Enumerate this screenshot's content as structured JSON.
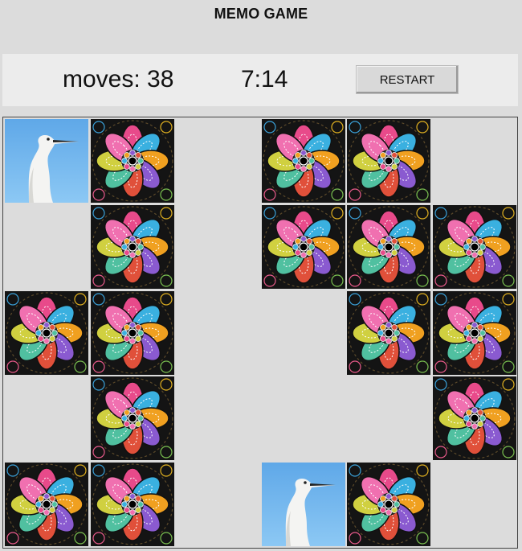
{
  "title": "MEMO GAME",
  "score": {
    "moves_label": "moves:",
    "moves": "38",
    "time": "7:14",
    "restart_label": "RESTART"
  },
  "board": {
    "rows": 5,
    "cols": 6,
    "cells": [
      [
        "egret",
        "mandala",
        "empty",
        "mandala",
        "mandala",
        "empty"
      ],
      [
        "empty",
        "mandala",
        "empty",
        "mandala",
        "mandala",
        "mandala"
      ],
      [
        "mandala",
        "mandala",
        "empty",
        "empty",
        "mandala",
        "mandala"
      ],
      [
        "empty",
        "mandala",
        "empty",
        "empty",
        "empty",
        "mandala"
      ],
      [
        "mandala",
        "mandala",
        "empty",
        "egret",
        "mandala",
        "empty"
      ]
    ]
  },
  "colors": {
    "background": "#dcdcdc",
    "scorebar": "#ececec",
    "board_border": "#444444",
    "sky": "#6fb6ee",
    "mandala_bg": "#141414"
  },
  "icons": {
    "card_back": "mandala-flower-icon",
    "revealed": "egret-bird-icon"
  }
}
